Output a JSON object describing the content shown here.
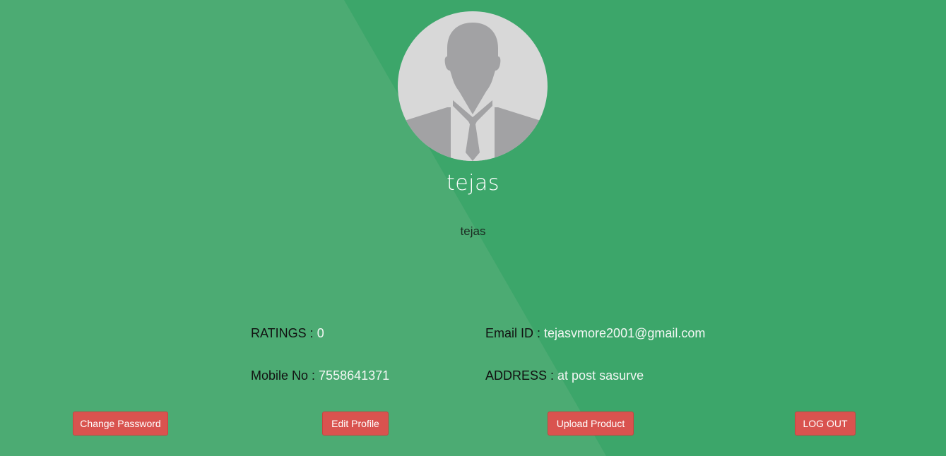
{
  "profile": {
    "display_name": "tejas",
    "username": "tejas"
  },
  "details": {
    "ratings_label": "RATINGS : ",
    "ratings_value": "0",
    "email_label": "Email ID : ",
    "email_value": "tejasvmore2001@gmail.com",
    "mobile_label": "Mobile No : ",
    "mobile_value": "7558641371",
    "address_label": "ADDRESS : ",
    "address_value": "at post sasurve"
  },
  "actions": {
    "change_password": "Change Password",
    "edit_profile": "Edit Profile",
    "upload_product": "Upload Product",
    "log_out": "LOG OUT"
  },
  "icons": {
    "avatar": "person-silhouette-icon"
  },
  "colors": {
    "background": "#3ca66a",
    "background_light": "#4cab73",
    "button": "#d9534f",
    "value_text": "#f3f7f4"
  }
}
